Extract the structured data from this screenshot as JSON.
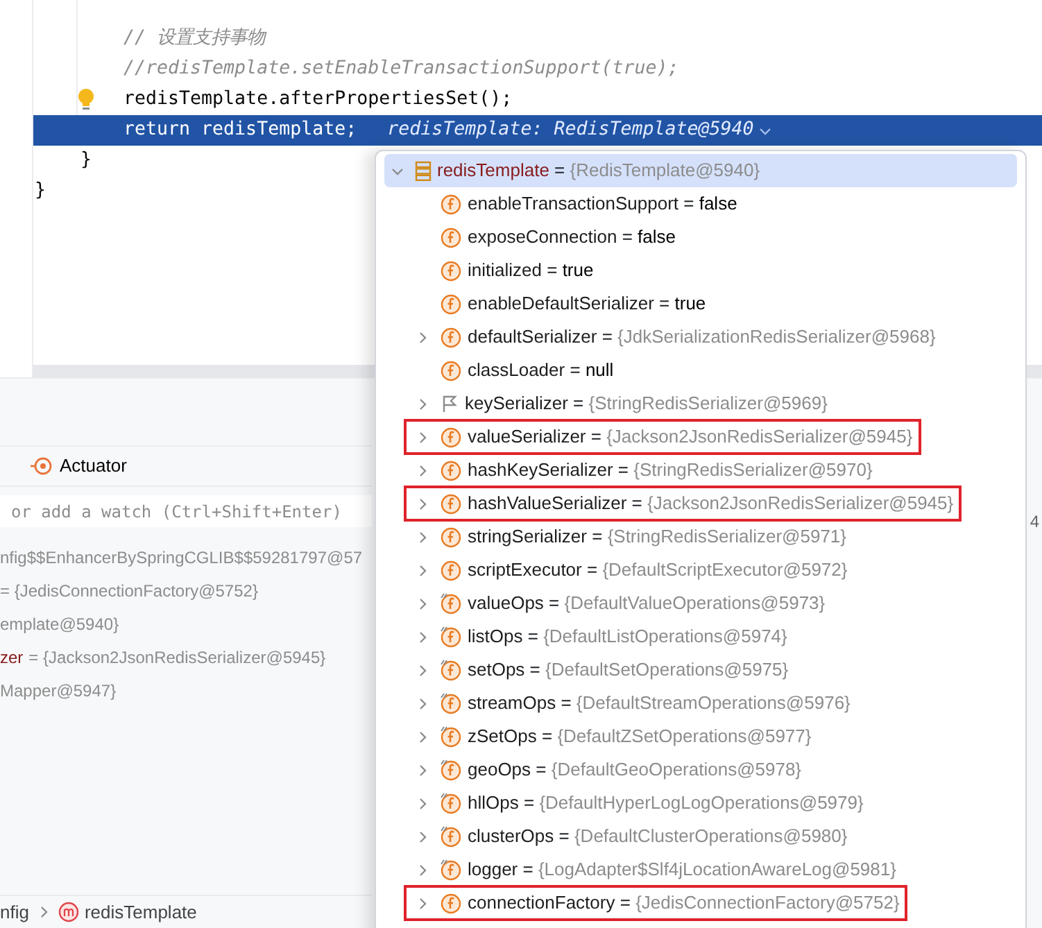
{
  "code_lines": [
    {
      "kind": "comment",
      "text": "// 设置支持事物"
    },
    {
      "kind": "comment",
      "text": "//redisTemplate.setEnableTransactionSupport(true);"
    },
    {
      "kind": "statement",
      "text": "redisTemplate.afterPropertiesSet();",
      "bulb": true
    },
    {
      "kind": "statement",
      "text": "return redisTemplate;",
      "selected": true,
      "hint": "redisTemplate: RedisTemplate@5940"
    },
    {
      "kind": "method_close",
      "text": "}"
    },
    {
      "kind": "class_close",
      "text": "}"
    }
  ],
  "debug_panel": {
    "tab": "Actuator",
    "watch_placeholder": "or add a watch (Ctrl+Shift+Enter)",
    "side_text": "4",
    "variables": [
      {
        "value": "nfig$$EnhancerBySpringCGLIB$$59281797@57"
      },
      {
        "value": "= {JedisConnectionFactory@5752}"
      },
      {
        "value": "emplate@5940}"
      },
      {
        "name": "zer",
        "value": "= {Jackson2JsonRedisSerializer@5945}"
      },
      {
        "value": "Mapper@5947}"
      }
    ],
    "breadcrumb": [
      {
        "text": "nfig",
        "kind": "plain"
      },
      {
        "text": "redisTemplate",
        "kind": "method"
      }
    ]
  },
  "popup": {
    "root": {
      "name": "redisTemplate",
      "separator": "=",
      "value": "{RedisTemplate@5940}",
      "expanded": true,
      "selected": true
    },
    "children": [
      {
        "kind": "field",
        "name": "enableTransactionSupport",
        "separator": "=",
        "value": "false",
        "value_dim": false,
        "expandable": false,
        "outlined": false
      },
      {
        "kind": "field",
        "name": "exposeConnection",
        "separator": "=",
        "value": "false",
        "value_dim": false,
        "expandable": false,
        "outlined": false
      },
      {
        "kind": "field",
        "name": "initialized",
        "separator": "=",
        "value": "true",
        "value_dim": false,
        "expandable": false,
        "outlined": false
      },
      {
        "kind": "field",
        "name": "enableDefaultSerializer",
        "separator": "=",
        "value": "true",
        "value_dim": false,
        "expandable": false,
        "outlined": false
      },
      {
        "kind": "field",
        "name": "defaultSerializer",
        "separator": "=",
        "value": "{JdkSerializationRedisSerializer@5968}",
        "value_dim": true,
        "expandable": true,
        "outlined": false
      },
      {
        "kind": "field",
        "name": "classLoader",
        "separator": "=",
        "value": "null",
        "value_dim": false,
        "expandable": false,
        "outlined": false
      },
      {
        "kind": "flag",
        "name": "keySerializer",
        "separator": "=",
        "value": "{StringRedisSerializer@5969}",
        "value_dim": true,
        "expandable": true,
        "outlined": false
      },
      {
        "kind": "field",
        "name": "valueSerializer",
        "separator": "=",
        "value": "{Jackson2JsonRedisSerializer@5945}",
        "value_dim": true,
        "expandable": true,
        "outlined": true
      },
      {
        "kind": "field",
        "name": "hashKeySerializer",
        "separator": "=",
        "value": "{StringRedisSerializer@5970}",
        "value_dim": true,
        "expandable": true,
        "outlined": false
      },
      {
        "kind": "field",
        "name": "hashValueSerializer",
        "separator": "=",
        "value": "{Jackson2JsonRedisSerializer@5945}",
        "value_dim": true,
        "expandable": true,
        "outlined": true
      },
      {
        "kind": "field",
        "name": "stringSerializer",
        "separator": "=",
        "value": "{StringRedisSerializer@5971}",
        "value_dim": true,
        "expandable": true,
        "outlined": false
      },
      {
        "kind": "field",
        "name": "scriptExecutor",
        "separator": "=",
        "value": "{DefaultScriptExecutor@5972}",
        "value_dim": true,
        "expandable": true,
        "outlined": false
      },
      {
        "kind": "final_field",
        "name": "valueOps",
        "separator": "=",
        "value": "{DefaultValueOperations@5973}",
        "value_dim": true,
        "expandable": true,
        "outlined": false
      },
      {
        "kind": "final_field",
        "name": "listOps",
        "separator": "=",
        "value": "{DefaultListOperations@5974}",
        "value_dim": true,
        "expandable": true,
        "outlined": false
      },
      {
        "kind": "final_field",
        "name": "setOps",
        "separator": "=",
        "value": "{DefaultSetOperations@5975}",
        "value_dim": true,
        "expandable": true,
        "outlined": false
      },
      {
        "kind": "final_field",
        "name": "streamOps",
        "separator": "=",
        "value": "{DefaultStreamOperations@5976}",
        "value_dim": true,
        "expandable": true,
        "outlined": false
      },
      {
        "kind": "final_field",
        "name": "zSetOps",
        "separator": "=",
        "value": "{DefaultZSetOperations@5977}",
        "value_dim": true,
        "expandable": true,
        "outlined": false
      },
      {
        "kind": "final_field",
        "name": "geoOps",
        "separator": "=",
        "value": "{DefaultGeoOperations@5978}",
        "value_dim": true,
        "expandable": true,
        "outlined": false
      },
      {
        "kind": "final_field",
        "name": "hllOps",
        "separator": "=",
        "value": "{DefaultHyperLogLogOperations@5979}",
        "value_dim": true,
        "expandable": true,
        "outlined": false
      },
      {
        "kind": "final_field",
        "name": "clusterOps",
        "separator": "=",
        "value": "{DefaultClusterOperations@5980}",
        "value_dim": true,
        "expandable": true,
        "outlined": false
      },
      {
        "kind": "final_field",
        "name": "logger",
        "separator": "=",
        "value": "{LogAdapter$Slf4jLocationAwareLog@5981}",
        "value_dim": true,
        "expandable": true,
        "outlined": false
      },
      {
        "kind": "field",
        "name": "connectionFactory",
        "separator": "=",
        "value": "{JedisConnectionFactory@5752}",
        "value_dim": true,
        "expandable": true,
        "outlined": true
      }
    ]
  }
}
